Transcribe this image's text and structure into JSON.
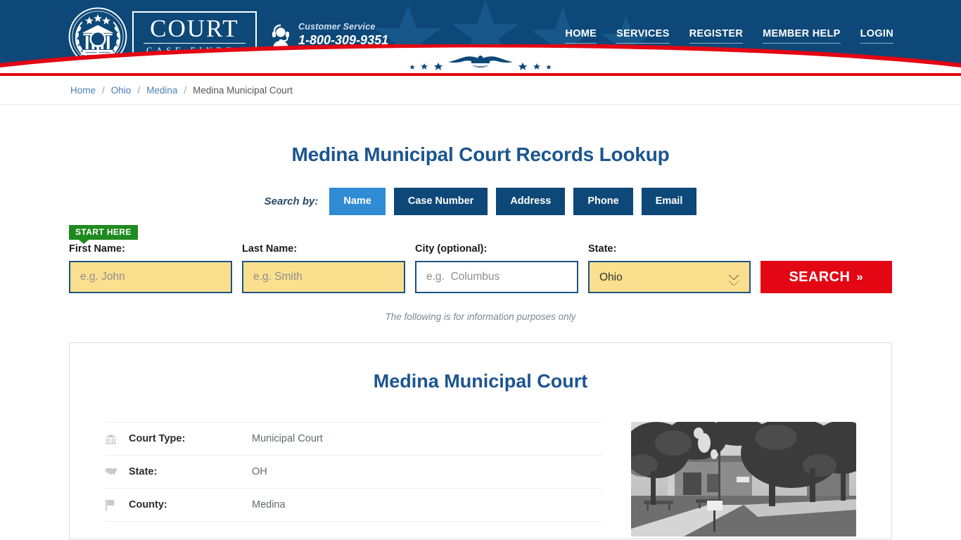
{
  "brand": {
    "logo_main": "COURT",
    "logo_sub": "CASE FINDER",
    "seal_icon": "court-seal-icon"
  },
  "customer_service": {
    "label": "Customer Service",
    "phone": "1-800-309-9351",
    "icon": "headset-agent-icon"
  },
  "nav": {
    "items": [
      {
        "label": "HOME"
      },
      {
        "label": "SERVICES"
      },
      {
        "label": "REGISTER"
      },
      {
        "label": "MEMBER HELP"
      },
      {
        "label": "LOGIN"
      }
    ]
  },
  "breadcrumb": {
    "items": [
      {
        "label": "Home",
        "current": false
      },
      {
        "label": "Ohio",
        "current": false
      },
      {
        "label": "Medina",
        "current": false
      },
      {
        "label": "Medina Municipal Court",
        "current": true
      }
    ],
    "separator": "/"
  },
  "page": {
    "title": "Medina Municipal Court Records Lookup",
    "info_note": "The following is for information purposes only"
  },
  "search": {
    "search_by_label": "Search by:",
    "tabs": [
      {
        "label": "Name",
        "active": true
      },
      {
        "label": "Case Number",
        "active": false
      },
      {
        "label": "Address",
        "active": false
      },
      {
        "label": "Phone",
        "active": false
      },
      {
        "label": "Email",
        "active": false
      }
    ],
    "start_here_badge": "START HERE",
    "fields": {
      "first_name": {
        "label": "First Name:",
        "placeholder": "e.g. John",
        "value": ""
      },
      "last_name": {
        "label": "Last Name:",
        "placeholder": "e.g. Smith",
        "value": ""
      },
      "city": {
        "label": "City (optional):",
        "placeholder": "e.g.  Columbus",
        "value": ""
      },
      "state": {
        "label": "State:",
        "value": "Ohio",
        "options": [
          "Ohio"
        ]
      }
    },
    "submit_label": "SEARCH",
    "submit_chevron": "»"
  },
  "court_card": {
    "title": "Medina Municipal Court",
    "details": [
      {
        "icon": "bank-building-icon",
        "label": "Court Type:",
        "value": "Municipal Court"
      },
      {
        "icon": "us-map-icon",
        "label": "State:",
        "value": "OH"
      },
      {
        "icon": "flag-icon",
        "label": "County:",
        "value": "Medina"
      }
    ],
    "photo_alt": "courthouse-photo"
  },
  "colors": {
    "header_blue": "#0d4878",
    "accent_red": "#e30613",
    "active_tab_blue": "#2e8bd4",
    "title_blue": "#1b5590",
    "field_yellow": "#fae08e",
    "badge_green": "#1f8a1f"
  }
}
